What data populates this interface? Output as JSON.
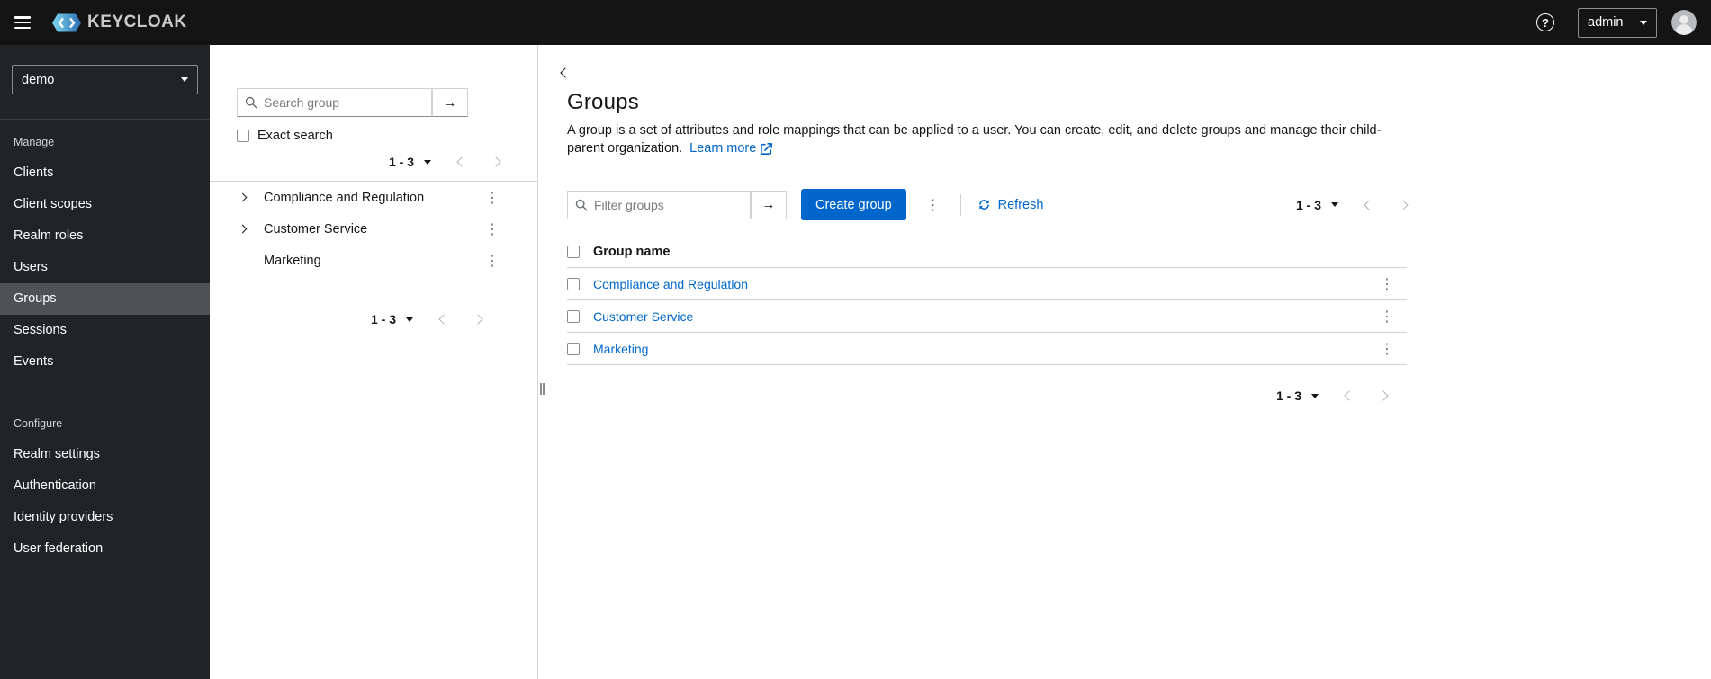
{
  "topbar": {
    "brand": "KEYCLOAK",
    "user": "admin"
  },
  "icons": {
    "kebab": "⋮",
    "search_submit": "→",
    "help": "?"
  },
  "sidebar": {
    "realm": "demo",
    "manage_label": "Manage",
    "manage_items": [
      "Clients",
      "Client scopes",
      "Realm roles",
      "Users",
      "Groups",
      "Sessions",
      "Events"
    ],
    "configure_label": "Configure",
    "configure_items": [
      "Realm settings",
      "Authentication",
      "Identity providers",
      "User federation"
    ],
    "selected_item": "Groups"
  },
  "tree_panel": {
    "search_placeholder": "Search group",
    "exact_search": "Exact search",
    "pagination_range": "1 - 3",
    "groups": [
      {
        "name": "Compliance and Regulation",
        "expandable": true
      },
      {
        "name": "Customer Service",
        "expandable": true
      },
      {
        "name": "Marketing",
        "expandable": false
      }
    ]
  },
  "main": {
    "title": "Groups",
    "description": "A group is a set of attributes and role mappings that can be applied to a user. You can create, edit, and delete groups and manage their child-parent organization.",
    "learn_more": "Learn more",
    "toolbar": {
      "filter_placeholder": "Filter groups",
      "create_button": "Create group",
      "refresh": "Refresh",
      "pagination_range": "1 - 3"
    },
    "table": {
      "name_column": "Group name",
      "rows": [
        "Compliance and Regulation",
        "Customer Service",
        "Marketing"
      ]
    },
    "bottom_pagination_range": "1 - 3"
  },
  "colors": {
    "primary": "#0066cc",
    "topbar_bg": "#141414",
    "sidebar_bg": "#212427",
    "selected_nav_bg": "#4f5255",
    "border": "#d2d2d2"
  }
}
